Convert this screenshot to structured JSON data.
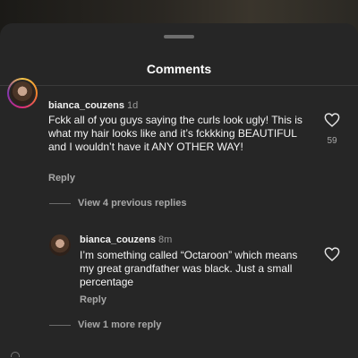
{
  "header": {
    "title": "Comments"
  },
  "comments": [
    {
      "username": "bianca_couzens",
      "time": "1d",
      "text": "Fckk all of you guys saying the curls look ugly! This is what my hair looks like and it’s fckkking BEAUTIFUL and I wouldn’t have it ANY OTHER WAY!",
      "reply_label": "Reply",
      "likes": "59",
      "view_replies": "View 4 previous replies"
    }
  ],
  "replies": [
    {
      "username": "bianca_couzens",
      "time": "8m",
      "text": "I’m something called “Octaroon” which means my great grandfather was black. Just a small percentage",
      "reply_label": "Reply",
      "view_more": "View 1 more reply"
    }
  ],
  "icons": {
    "like": "heart-outline-icon",
    "avatar": "profile-avatar"
  },
  "colors": {
    "sheet": "#262626",
    "muted": "#a8a8a8",
    "text": "#f5f5f5"
  }
}
